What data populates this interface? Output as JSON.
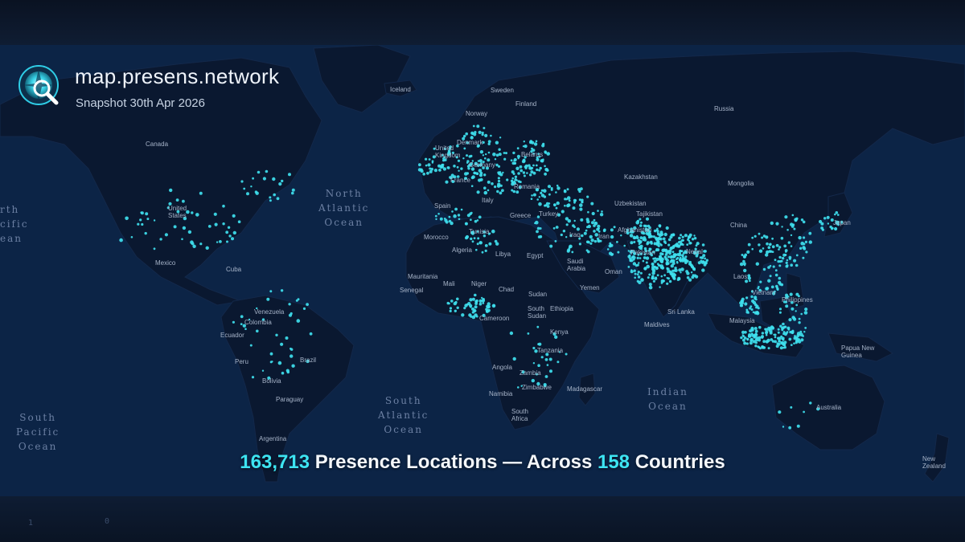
{
  "header": {
    "site": "map.presens.network",
    "snapshot": "Snapshot 30th Apr 2026",
    "logo_icon": "magnifier-globe-icon"
  },
  "stats": {
    "locations_count": "163,713",
    "locations_label": "Presence Locations — Across",
    "countries_count": "158",
    "countries_label": "Countries"
  },
  "colors": {
    "accent": "#3de4f2",
    "ocean": "#0c2446",
    "land": "#0a1830"
  },
  "oceans": {
    "north_atlantic": "North\nAtlantic\nOcean",
    "north_pacific": "rth\ncific\nean",
    "south_atlantic": "South\nAtlantic\nOcean",
    "south_pacific": "South\nPacific\nOcean",
    "indian": "Indian\nOcean"
  },
  "places": {
    "iceland": "Iceland",
    "sweden": "Sweden",
    "finland": "Finland",
    "norway": "Norway",
    "russia": "Russia",
    "canada": "Canada",
    "denmark": "Denmark",
    "uk": "United\nKingdom",
    "belarus": "Belarus",
    "germany": "Germany",
    "france": "France",
    "romania": "Romania",
    "kazakhstan": "Kazakhstan",
    "mongolia": "Mongolia",
    "italy": "Italy",
    "spain": "Spain",
    "uzbekistan": "Uzbekistan",
    "tajikistan": "Tajikistan",
    "greece": "Greece",
    "turkey": "Turkey",
    "us": "United\nStates",
    "china": "China",
    "japan": "Japan",
    "tunisia": "Tunisia",
    "iraq": "Iraq",
    "iran": "Iran",
    "afghanistan": "Afghanistan",
    "morocco": "Morocco",
    "algeria": "Algeria",
    "libya": "Libya",
    "egypt": "Egypt",
    "saudi": "Saudi\nArabia",
    "oman": "Oman",
    "pakistan": "Pakistan",
    "nepal": "Nepal",
    "mexico": "Mexico",
    "cuba": "Cuba",
    "laos": "Laos",
    "mauritania": "Mauritania",
    "mali": "Mali",
    "niger": "Niger",
    "chad": "Chad",
    "sudan": "Sudan",
    "yemen": "Yemen",
    "senegal": "Senegal",
    "vietnam": "Vietnam",
    "philippines": "Philippines",
    "venezuela": "Venezuela",
    "south_sudan": "South\nSudan",
    "ethiopia": "Ethiopia",
    "srilanka": "Sri Lanka",
    "colombia": "Colombia",
    "cameroon": "Cameroon",
    "malaysia": "Malaysia",
    "maldives": "Maldives",
    "ecuador": "Ecuador",
    "kenya": "Kenya",
    "tanzania": "Tanzania",
    "png": "Papua New\nGuinea",
    "peru": "Peru",
    "brazil": "Brazil",
    "angola": "Angola",
    "zambia": "Zambia",
    "bolivia": "Bolivia",
    "zimbabwe": "Zimbabwe",
    "madagascar": "Madagascar",
    "namibia": "Namibia",
    "paraguay": "Paraguay",
    "australia": "Australia",
    "south_africa": "South\nAfrica",
    "argentina": "Argentina",
    "nz": "New\nZealand"
  }
}
